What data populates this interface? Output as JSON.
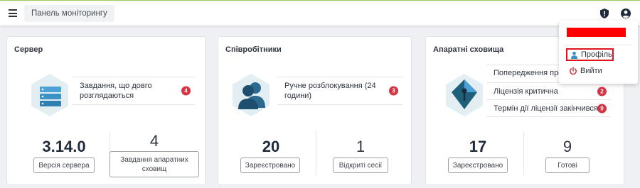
{
  "header": {
    "breadcrumb": "Панель моніторингу",
    "menu_icon": "menu-icon",
    "shield_icon": "shield-alert-icon",
    "user_icon": "user-circle-icon"
  },
  "cards": {
    "server": {
      "title": "Сервер",
      "icon": "server-icon",
      "rows": [
        {
          "text": "Завдання, що довго розглядаються",
          "count": "4"
        }
      ],
      "stats": [
        {
          "value": "3.14.0",
          "label": "Версія сервера"
        },
        {
          "value": "4",
          "label": "Завдання апаратних сховищ"
        }
      ]
    },
    "employees": {
      "title": "Співробітники",
      "icon": "users-icon",
      "rows": [
        {
          "text": "Ручне розблокування (24 години)",
          "count": "3"
        }
      ],
      "stats": [
        {
          "value": "20",
          "label": "Зареєстровано"
        },
        {
          "value": "1",
          "label": "Відкриті сесії"
        }
      ]
    },
    "storage": {
      "title": "Апаратні сховища",
      "icon": "usb-key-icon",
      "rows": [
        {
          "text": "Попередження про ...",
          "count": ""
        },
        {
          "text": "Ліцензія критична",
          "count": "2"
        },
        {
          "text": "Термін дії ліцензії закінчився",
          "count": "9"
        }
      ],
      "stats": [
        {
          "value": "17",
          "label": "Зареєстровано"
        },
        {
          "value": "9",
          "label": "Готові"
        }
      ]
    }
  },
  "user_menu": {
    "username_redacted": true,
    "profile": "Профіль",
    "logout": "Вийти"
  },
  "colors": {
    "badge": "#d63344",
    "icon_primary": "#1e5f7a",
    "icon_accent": "#4aa3d4",
    "highlight": "#e0141e"
  }
}
